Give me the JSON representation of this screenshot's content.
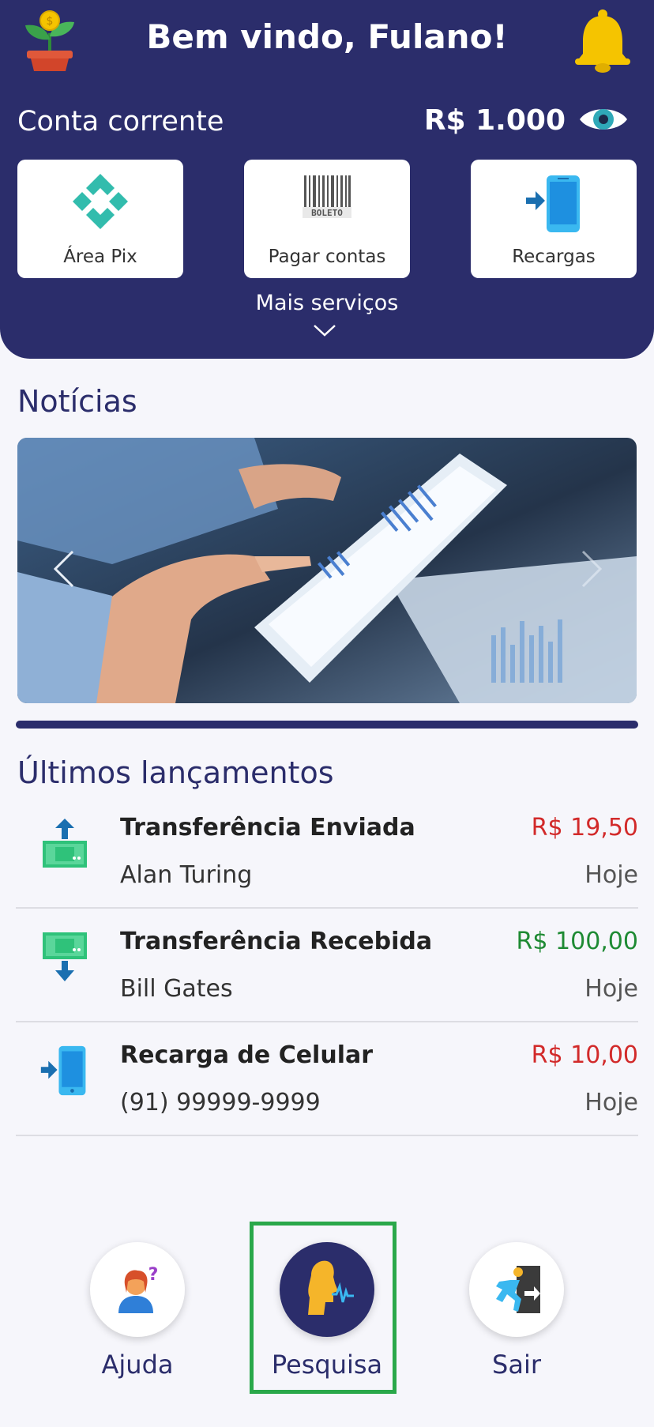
{
  "header": {
    "welcome": "Bem vindo, Fulano!",
    "account_label": "Conta corrente",
    "balance": "R$ 1.000",
    "icons": {
      "logo": "plant-coin-icon",
      "notifications": "bell-icon",
      "visibility": "eye-icon"
    }
  },
  "services": [
    {
      "label": "Área Pix",
      "icon": "pix-icon"
    },
    {
      "label": "Pagar contas",
      "icon": "barcode-boleto-icon",
      "icon_text": "BOLETO"
    },
    {
      "label": "Recargas",
      "icon": "phone-recharge-icon"
    }
  ],
  "more_services": "Mais serviços",
  "news": {
    "title": "Notícias"
  },
  "transactions": {
    "title": "Últimos lançamentos",
    "items": [
      {
        "title": "Transferência Enviada",
        "subtitle": "Alan Turing",
        "amount": "R$ 19,50",
        "date": "Hoje",
        "icon": "money-sent-icon"
      },
      {
        "title": "Transferência Recebida",
        "subtitle": "Bill Gates",
        "amount": "R$ 100,00",
        "date": "Hoje",
        "icon": "money-received-icon"
      },
      {
        "title": "Recarga de Celular",
        "subtitle": "(91) 99999-9999",
        "amount": "R$ 10,00",
        "date": "Hoje",
        "icon": "phone-recharge-icon"
      }
    ]
  },
  "bottom_nav": [
    {
      "label": "Ajuda",
      "icon": "help-person-icon"
    },
    {
      "label": "Pesquisa",
      "icon": "voice-search-icon"
    },
    {
      "label": "Sair",
      "icon": "exit-door-icon"
    }
  ],
  "colors": {
    "primary": "#2b2d6b",
    "debit": "#d22a2a",
    "credit": "#1e8a33",
    "highlight": "#2aa84a",
    "bell": "#f5c400"
  }
}
